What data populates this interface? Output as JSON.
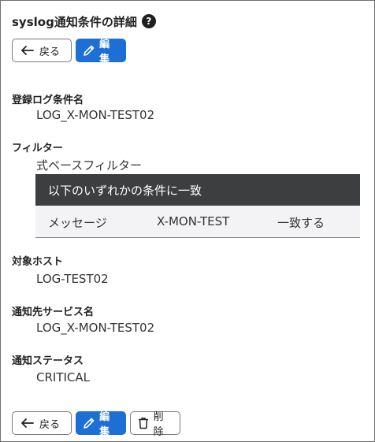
{
  "page": {
    "title": "syslog通知条件の詳細",
    "help_icon": "question-circle-icon"
  },
  "buttons": {
    "back_label": "戻る",
    "edit_label": "編集",
    "delete_label": "削除",
    "back_icon": "arrow-left-icon",
    "edit_icon": "pencil-icon",
    "delete_icon": "trash-icon",
    "edit_color": "#1d6fd6"
  },
  "fields": {
    "log_condition_name": {
      "label": "登録ログ条件名",
      "value": "LOG_X-MON-TEST02"
    },
    "filter": {
      "label": "フィルター",
      "value": "式ベースフィルター"
    },
    "target_host": {
      "label": "対象ホスト",
      "value": "LOG-TEST02"
    },
    "notify_service": {
      "label": "通知先サービス名",
      "value": "LOG_X-MON-TEST02"
    },
    "notify_status": {
      "label": "通知ステータス",
      "value": "CRITICAL"
    }
  },
  "filter_table": {
    "header": "以下のいずれかの条件に一致",
    "rows": [
      {
        "field": "メッセージ",
        "pattern": "X-MON-TEST",
        "match": "一致する"
      }
    ]
  }
}
